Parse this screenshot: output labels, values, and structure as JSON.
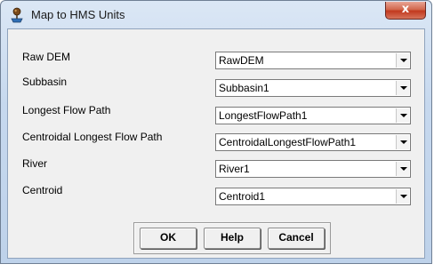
{
  "window": {
    "title": "Map to HMS Units",
    "close_glyph": "x",
    "icon": "hms-app-icon"
  },
  "fields": [
    {
      "label": "Raw DEM",
      "value": "RawDEM"
    },
    {
      "label": "Subbasin",
      "value": "Subbasin1"
    },
    {
      "label": "Longest Flow Path",
      "value": "LongestFlowPath1"
    },
    {
      "label": "Centroidal Longest Flow Path",
      "value": "CentroidalLongestFlowPath1"
    },
    {
      "label": "River",
      "value": "River1"
    },
    {
      "label": "Centroid",
      "value": "Centroid1"
    }
  ],
  "buttons": {
    "ok": "OK",
    "help": "Help",
    "cancel": "Cancel"
  },
  "colors": {
    "close_button": "#c8432a",
    "title_bar": "#c6d8ee",
    "dialog_background": "#f0f0f0"
  }
}
